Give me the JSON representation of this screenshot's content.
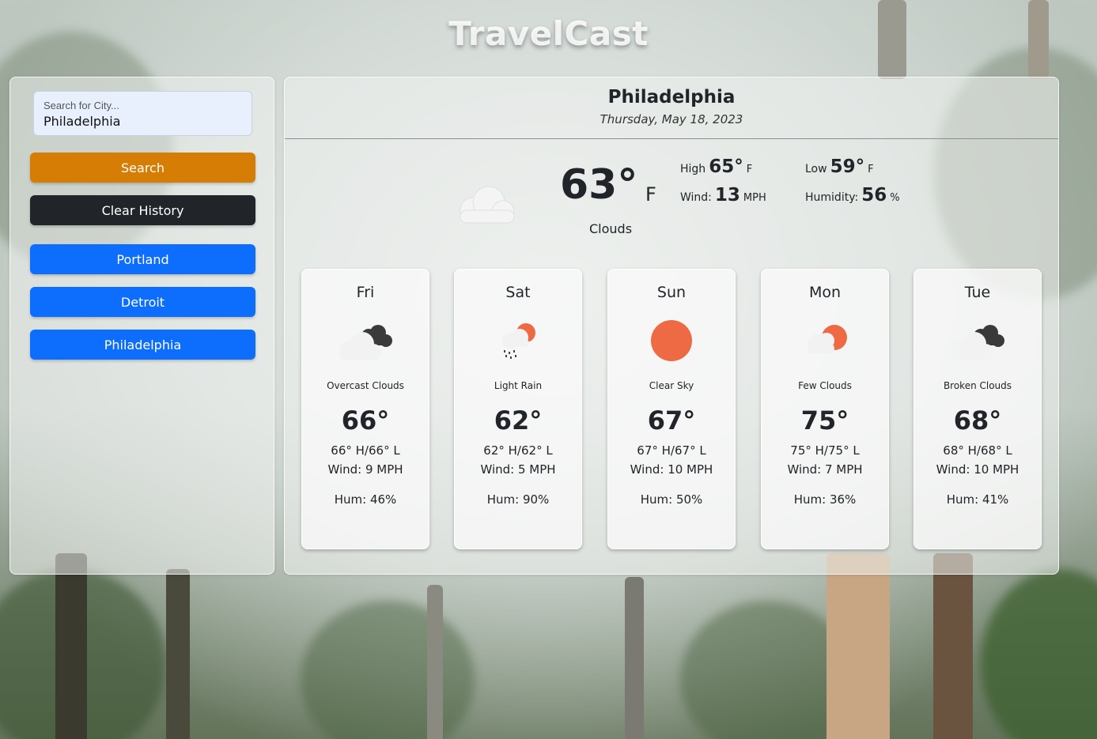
{
  "app": {
    "title": "TravelCast"
  },
  "sidebar": {
    "search": {
      "label": "Search for City...",
      "value": "Philadelphia"
    },
    "search_button": "Search",
    "clear_button": "Clear History",
    "history": [
      "Portland",
      "Detroit",
      "Philadelphia"
    ]
  },
  "current": {
    "city": "Philadelphia",
    "date": "Thursday, May 18, 2023",
    "icon": "clouds-icon",
    "temp": "63°",
    "unit": "F",
    "description": "Clouds",
    "high_label": "High",
    "high_value": "65°",
    "high_unit": "F",
    "low_label": "Low",
    "low_value": "59°",
    "low_unit": "F",
    "wind_label": "Wind:",
    "wind_value": "13",
    "wind_unit": "MPH",
    "humidity_label": "Humidity:",
    "humidity_value": "56",
    "humidity_unit": "%"
  },
  "forecast": [
    {
      "day": "Fri",
      "icon": "overcast-clouds-icon",
      "description": "Overcast Clouds",
      "temp": "66°",
      "hl": "66° H/66° L",
      "wind": "Wind: 9 MPH",
      "humidity": "Hum: 46%"
    },
    {
      "day": "Sat",
      "icon": "light-rain-icon",
      "description": "Light Rain",
      "temp": "62°",
      "hl": "62° H/62° L",
      "wind": "Wind: 5 MPH",
      "humidity": "Hum: 90%"
    },
    {
      "day": "Sun",
      "icon": "clear-sky-icon",
      "description": "Clear Sky",
      "temp": "67°",
      "hl": "67° H/67° L",
      "wind": "Wind: 10 MPH",
      "humidity": "Hum: 50%"
    },
    {
      "day": "Mon",
      "icon": "few-clouds-icon",
      "description": "Few Clouds",
      "temp": "75°",
      "hl": "75° H/75° L",
      "wind": "Wind: 7 MPH",
      "humidity": "Hum: 36%"
    },
    {
      "day": "Tue",
      "icon": "broken-clouds-icon",
      "description": "Broken Clouds",
      "temp": "68°",
      "hl": "68° H/68° L",
      "wind": "Wind: 10 MPH",
      "humidity": "Hum: 41%"
    }
  ],
  "colors": {
    "search_button": "#d67d06",
    "clear_button": "#212529",
    "history_button": "#0d6efd",
    "sun": "#ee6a44"
  }
}
